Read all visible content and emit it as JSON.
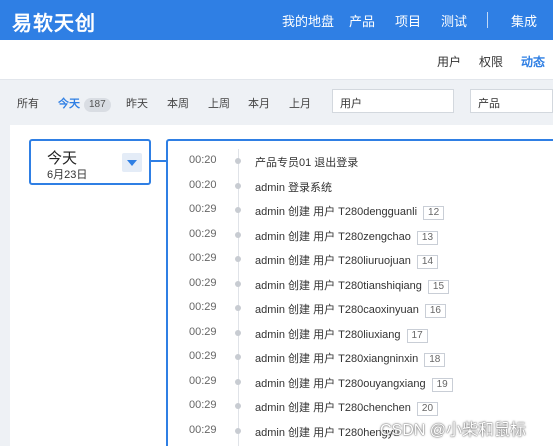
{
  "header": {
    "brand": "易软天创",
    "nav": [
      "我的地盘",
      "产品",
      "项目",
      "测试",
      "集成"
    ]
  },
  "subnav": {
    "items": [
      "用户",
      "权限",
      "动态"
    ],
    "active": "动态"
  },
  "filters": {
    "tabs": [
      {
        "label": "所有"
      },
      {
        "label": "今天",
        "count": "187"
      },
      {
        "label": "昨天"
      },
      {
        "label": "本周"
      },
      {
        "label": "上周"
      },
      {
        "label": "本月"
      },
      {
        "label": "上月"
      }
    ],
    "active": "今天",
    "user_select": "用户",
    "product_select": "产品"
  },
  "date_group": {
    "day": "今天",
    "date": "6月23日"
  },
  "events": [
    {
      "time": "00:20",
      "text": "产品专员01 退出登录",
      "id": ""
    },
    {
      "time": "00:20",
      "text": "admin 登录系统",
      "id": ""
    },
    {
      "time": "00:29",
      "text": "admin 创建 用户 T280dengguanli",
      "id": "12"
    },
    {
      "time": "00:29",
      "text": "admin 创建 用户 T280zengchao",
      "id": "13"
    },
    {
      "time": "00:29",
      "text": "admin 创建 用户 T280liuruojuan",
      "id": "14"
    },
    {
      "time": "00:29",
      "text": "admin 创建 用户 T280tianshiqiang",
      "id": "15"
    },
    {
      "time": "00:29",
      "text": "admin 创建 用户 T280caoxinyuan",
      "id": "16"
    },
    {
      "time": "00:29",
      "text": "admin 创建 用户 T280liuxiang",
      "id": "17"
    },
    {
      "time": "00:29",
      "text": "admin 创建 用户 T280xiangninxin",
      "id": "18"
    },
    {
      "time": "00:29",
      "text": "admin 创建 用户 T280ouyangxiang",
      "id": "19"
    },
    {
      "time": "00:29",
      "text": "admin 创建 用户 T280chenchen",
      "id": "20"
    },
    {
      "time": "00:29",
      "text": "admin 创建 用户 T280hengyu",
      "id": ""
    }
  ],
  "watermark": "CSDN @小柴和鼠标"
}
